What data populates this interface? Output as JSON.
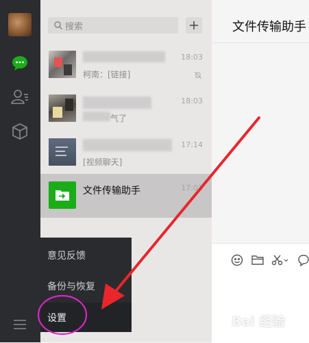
{
  "sidebar": {
    "nav": [
      {
        "icon": "chat-bubble-icon",
        "active": true
      },
      {
        "icon": "contacts-icon",
        "active": false
      },
      {
        "icon": "favorites-cube-icon",
        "active": false
      }
    ],
    "menu_icon": "hamburger-menu-icon"
  },
  "search": {
    "placeholder": "搜索"
  },
  "chats": [
    {
      "name": "",
      "preview": "柯南：[链接]",
      "time": "18:03",
      "muted": true
    },
    {
      "name": "",
      "preview": "气了",
      "time": "18:03",
      "muted": false
    },
    {
      "name": "",
      "preview": "[视频聊天]",
      "time": "17:14",
      "muted": false
    },
    {
      "name": "文件传输助手",
      "preview": "",
      "time": "17:01",
      "muted": false,
      "active": true
    }
  ],
  "popup_menu": {
    "items": [
      "意见反馈",
      "备份与恢复",
      "设置"
    ]
  },
  "main": {
    "title": "文件传输助手",
    "toolbar_icons": [
      "emoji-icon",
      "folder-icon",
      "scissors-icon",
      "chat-history-icon"
    ]
  },
  "watermark": "Bai 经验",
  "colors": {
    "accent_green": "#1aad19",
    "annotation_red": "#e8262b",
    "annotation_magenta": "#d726c9"
  }
}
